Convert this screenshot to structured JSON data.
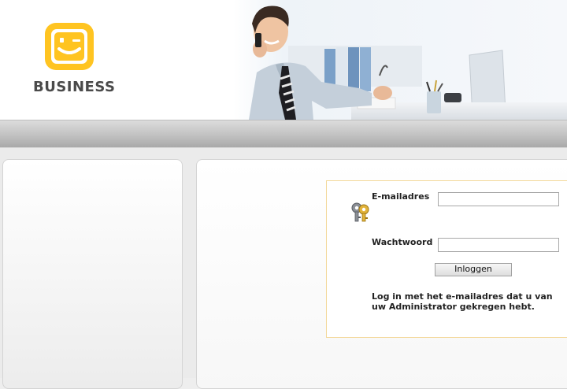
{
  "header": {
    "brand": "BUSINESS",
    "logo_icon": "smiley-wink-logo-icon",
    "banner_image": "businessman-on-phone-photo"
  },
  "login": {
    "email_label": "E-mailadres",
    "email_value": "",
    "password_label": "Wachtwoord",
    "password_value": "",
    "submit_label": "Inloggen",
    "info_text": "Log in met het e-mailadres dat u van uw Administrator gekregen hebt.",
    "keys_icon": "keys-icon"
  },
  "colors": {
    "brand_yellow": "#FFC421",
    "brand_text": "#4A4A4A",
    "login_border": "#F3D89A"
  }
}
